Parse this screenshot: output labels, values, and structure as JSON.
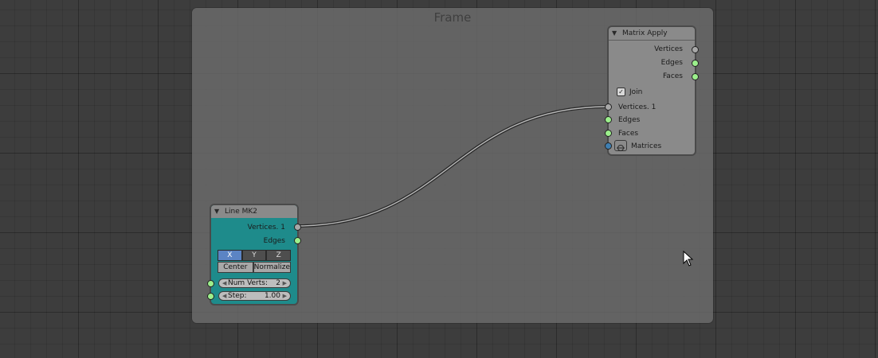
{
  "frame": {
    "title": "Frame"
  },
  "matrix_apply": {
    "title": "Matrix Apply",
    "outputs": [
      "Vertices",
      "Edges",
      "Faces"
    ],
    "join_label": "Join",
    "join_checked": true,
    "inputs": [
      "Vertices. 1",
      "Edges",
      "Faces",
      "Matrices"
    ]
  },
  "line_mk2": {
    "title": "Line MK2",
    "outputs": [
      "Vertices. 1",
      "Edges"
    ],
    "axes": [
      "X",
      "Y",
      "Z"
    ],
    "active_axis": "X",
    "options": [
      "Center",
      "Normalize"
    ],
    "num_verts_label": "Num Verts:",
    "num_verts_value": "2",
    "step_label": "Step:",
    "step_value": "1.00"
  },
  "colors": {
    "line_node_body": "#1e8b8b",
    "matrix_node_body": "#8a8a8a",
    "socket_vertices": "#a8a8a8",
    "socket_edges": "#9cf08c",
    "socket_matrices": "#3f7fb1",
    "active_axis": "#5b84c4"
  }
}
